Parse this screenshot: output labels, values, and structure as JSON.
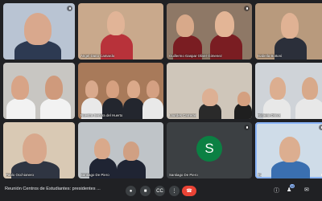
{
  "participants": [
    {
      "name": "",
      "bg": "#b9c4d3"
    },
    {
      "name": "Angel Dario Camardo",
      "bg": "#c9a98c"
    },
    {
      "name": "Guillermo Gaspar Oliver Gimenez",
      "bg": "#8e7866"
    },
    {
      "name": "Isabella Bottoni",
      "bg": "#b89a7d"
    },
    {
      "name": "",
      "bg": "#c8c6c2"
    },
    {
      "name": "Nuestra Señora del Huerto",
      "bg": "#a87a5a"
    },
    {
      "name": "Lourdes Carreras",
      "bg": "#cfc6ba"
    },
    {
      "name": "Rafaela Olmos",
      "bg": "#cfd3d8"
    },
    {
      "name": "Pablo Occhionero",
      "bg": "#d9c9b4"
    },
    {
      "name": "Santiago De Piero",
      "bg": "#bfc4c8"
    },
    {
      "name": "Santiago De Piero",
      "bg": "#3c4043",
      "initial": "S"
    },
    {
      "name": "Tú",
      "bg": "#cfdce8"
    }
  ],
  "bottom_bar": {
    "meeting_title": "Reunión Centros de Estudiantes: presidentes ...",
    "people_count": "12"
  },
  "icons": {
    "mic": "mic-icon",
    "camera": "camera-icon",
    "captions": "captions-icon",
    "present": "present-icon",
    "more": "more-options-icon",
    "end": "end-call-icon",
    "info": "info-icon",
    "people": "people-icon",
    "chat": "chat-icon"
  },
  "colors": {
    "accent": "#8ab4f8",
    "end_call": "#ea4335",
    "avatar": "#0b8043"
  }
}
